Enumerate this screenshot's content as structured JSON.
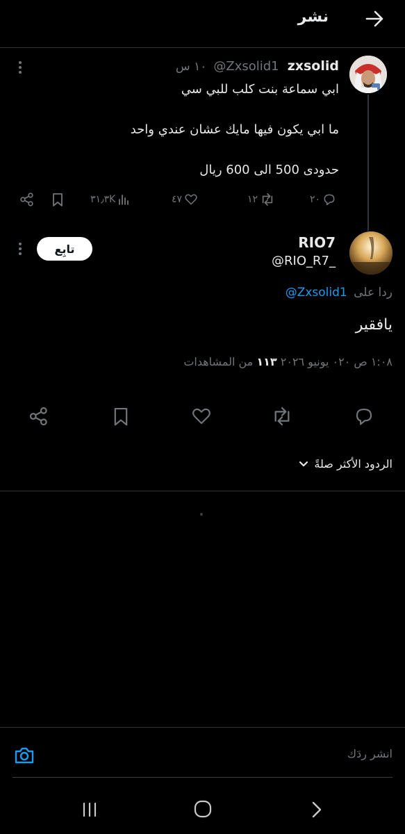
{
  "header": {
    "title": "نشر"
  },
  "parent_tweet": {
    "display_name": "zxsolid",
    "handle": "@Zxsolid1",
    "time": "١٠ س",
    "lines": [
      "ابي سماعة بنت كلب للبي سي",
      "ما ابي يكون فيها مايك عشان عندي واحد",
      "حدودى 500 الى 600 ريال"
    ],
    "stats": {
      "replies": "٢٠",
      "retweets": "١٢",
      "likes": "٤٧",
      "views": "٣١٫٣K"
    }
  },
  "main_tweet": {
    "display_name": "RIO7",
    "handle": "@RIO_R7_",
    "follow_label": "تابِع",
    "reply_prefix": "ردا على",
    "reply_to": "@Zxsolid1",
    "text": "يافقير",
    "meta_prefix": "١:٠٨ ص ٠٢٠ يونيو ٢٠٢٦ ",
    "views_count": "١١٣",
    "views_label": "من المشاهدات"
  },
  "relevant_replies_label": "الردود الأكثر صلةً",
  "composer": {
    "placeholder": "انشر ردَك"
  },
  "colors": {
    "background": "#000000",
    "text": "#e7e9ea",
    "muted": "#71767b",
    "divider": "#2f3336",
    "accent": "#1d9bf0"
  }
}
